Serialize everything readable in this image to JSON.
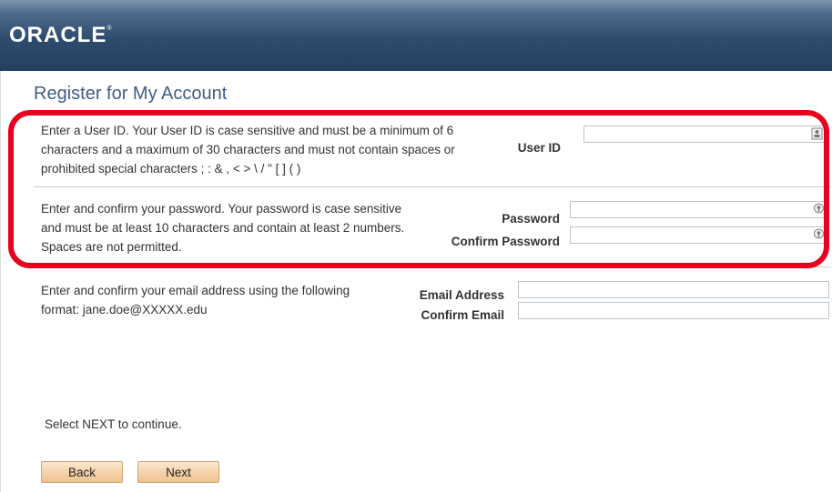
{
  "header": {
    "logo_text": "ORACLE",
    "logo_mark": "®"
  },
  "page": {
    "title": "Register for My Account"
  },
  "userid_section": {
    "lines": [
      "Enter a User ID.  Your User ID is case sensitive and must be a minimum of 6",
      "characters and a maximum of 30 characters and must not contain spaces or",
      "prohibited special characters  ;  :  &  ,  <  >  \\  /  \"  [  ]  (  )"
    ],
    "label": "User ID",
    "value": ""
  },
  "password_section": {
    "lines": [
      "Enter and confirm your password.  Your password is case sensitive",
      "and must be at least 10 characters and contain at least 2 numbers.",
      "Spaces are not permitted."
    ],
    "password_label": "Password",
    "confirm_label": "Confirm Password",
    "password_value": "",
    "confirm_value": ""
  },
  "email_section": {
    "lines": [
      "Enter and confirm your email address using the following",
      "format: jane.doe@XXXXX.edu"
    ],
    "email_label": "Email Address",
    "confirm_label": "Confirm Email",
    "email_value": "",
    "confirm_value": ""
  },
  "footer": {
    "instruction": "Select NEXT to continue.",
    "back_label": "Back",
    "next_label": "Next"
  },
  "colors": {
    "header_bg": "#2e4c6e",
    "title": "#3f5e85",
    "highlight": "#e8001c",
    "button_bg": "#f5d2a8"
  },
  "icons": {
    "userid_field": "contact-card-icon",
    "password_field": "key-icon"
  }
}
